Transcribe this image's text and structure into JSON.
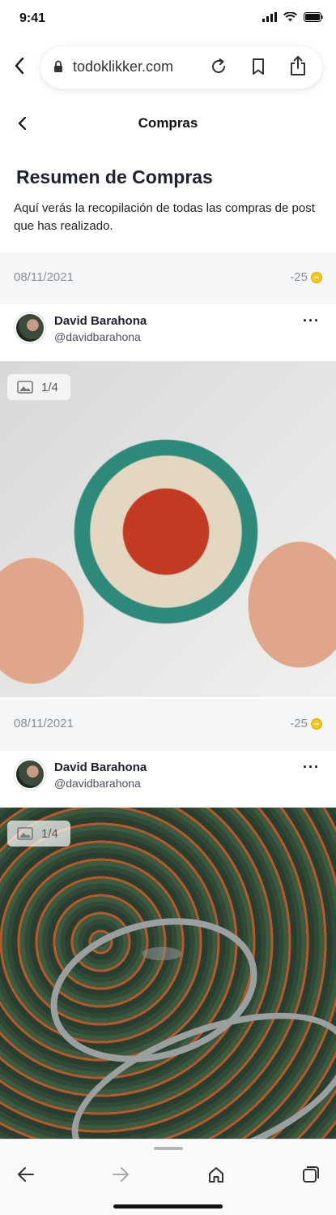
{
  "status": {
    "time": "9:41"
  },
  "browser": {
    "url": "todoklikker.com"
  },
  "header": {
    "title": "Compras"
  },
  "summary": {
    "title": "Resumen de Compras",
    "description": "Aquí verás la recopilación de todas las compras de post que has realizado."
  },
  "purchases": [
    {
      "date": "08/11/2021",
      "cost": "-25",
      "author": {
        "name": "David Barahona",
        "handle": "@davidbarahona"
      },
      "image_counter": "1/4",
      "image": "bowl-of-food-photo"
    },
    {
      "date": "08/11/2021",
      "cost": "-25",
      "author": {
        "name": "David Barahona",
        "handle": "@davidbarahona"
      },
      "image_counter": "1/4",
      "image": "forest-road-photo"
    }
  ],
  "more_label": "···",
  "colors": {
    "coin": "#f5c518",
    "muted": "#8a8f99",
    "bar_bg": "#f5f6f8"
  }
}
